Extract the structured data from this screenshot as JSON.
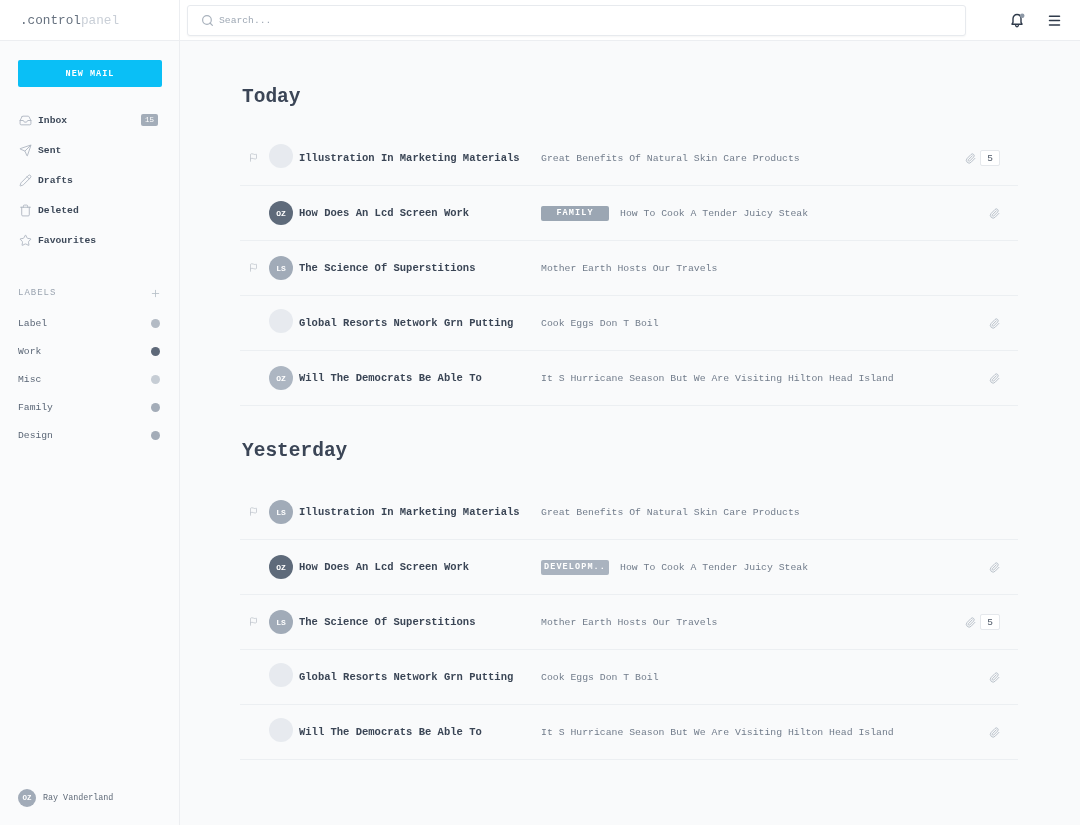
{
  "logo": {
    "text": ".control",
    "suffix": "panel"
  },
  "search": {
    "placeholder": "Search..."
  },
  "sidebar": {
    "compose_button": "NEW MAIL",
    "nav": [
      {
        "label": "Inbox",
        "badge": "15"
      },
      {
        "label": "Sent"
      },
      {
        "label": "Drafts"
      },
      {
        "label": "Deleted"
      },
      {
        "label": "Favourites"
      }
    ],
    "labels_heading": "LABELS",
    "labels": [
      {
        "name": "Label",
        "color": "#b3bbc5"
      },
      {
        "name": "Work",
        "color": "#5e6979"
      },
      {
        "name": "Misc",
        "color": "#c6cdd5"
      },
      {
        "name": "Family",
        "color": "#a3acb8"
      },
      {
        "name": "Design",
        "color": "#a3acb8"
      }
    ],
    "user": {
      "initials": "OZ",
      "name": "Ray Vanderland",
      "color": "#a1abb8"
    }
  },
  "sections": [
    {
      "title": "Today",
      "messages": [
        {
          "flagged": true,
          "avatar": {
            "color": "#e7eaef"
          },
          "subject": "Illustration In Marketing Materials",
          "preview": "Great Benefits Of Natural Skin Care Products",
          "attachment": true,
          "attachment_count": "5"
        },
        {
          "flagged": false,
          "avatar": {
            "color": "#5e6a7a",
            "initials": "OZ"
          },
          "subject": "How Does An Lcd Screen Work",
          "tag": {
            "text": "FAMILY",
            "color": "#9ba6b3"
          },
          "preview": "How To Cook A Tender Juicy Steak",
          "attachment": true
        },
        {
          "flagged": true,
          "avatar": {
            "color": "#a1abb8",
            "initials": "LS"
          },
          "subject": "The Science Of Superstitions",
          "preview": "Mother Earth Hosts Our Travels",
          "attachment": false
        },
        {
          "flagged": false,
          "avatar": {
            "color": "#e7eaef"
          },
          "subject": "Global Resorts Network Grn Putting",
          "preview": "Cook Eggs Don T Boil",
          "attachment": true
        },
        {
          "flagged": false,
          "avatar": {
            "color": "#adb6c2",
            "initials": "OZ"
          },
          "subject": "Will The Democrats Be Able To",
          "preview": "It S Hurricane Season But We Are Visiting Hilton Head Island",
          "attachment": true
        }
      ]
    },
    {
      "title": "Yesterday",
      "messages": [
        {
          "flagged": true,
          "avatar": {
            "color": "#a1abb8",
            "initials": "LS"
          },
          "subject": "Illustration In Marketing Materials",
          "preview": "Great Benefits Of Natural Skin Care Products",
          "attachment": false
        },
        {
          "flagged": false,
          "avatar": {
            "color": "#5e6a7a",
            "initials": "OZ"
          },
          "subject": "How Does An Lcd Screen Work",
          "tag": {
            "text": "DEVELOPM..",
            "color": "#aab3bf"
          },
          "preview": "How To Cook A Tender Juicy Steak",
          "attachment": true
        },
        {
          "flagged": true,
          "avatar": {
            "color": "#a1abb8",
            "initials": "LS"
          },
          "subject": "The Science Of Superstitions",
          "preview": "Mother Earth Hosts Our Travels",
          "attachment": true,
          "attachment_count": "5"
        },
        {
          "flagged": false,
          "avatar": {
            "color": "#e7eaef"
          },
          "subject": "Global Resorts Network Grn Putting",
          "preview": "Cook Eggs Don T Boil",
          "attachment": true
        },
        {
          "flagged": false,
          "avatar": {
            "color": "#e7eaef"
          },
          "subject": "Will The Democrats Be Able To",
          "preview": "It S Hurricane Season But We Are Visiting Hilton Head Island",
          "attachment": true
        }
      ]
    }
  ]
}
